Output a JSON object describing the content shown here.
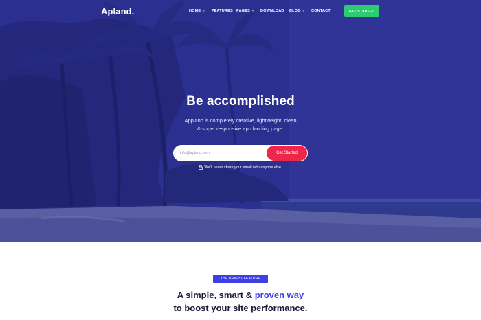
{
  "brand": {
    "name": "Apland."
  },
  "nav": {
    "items": [
      {
        "label": "HOME",
        "has_dropdown": true
      },
      {
        "label": "FEATURES",
        "has_dropdown": false
      },
      {
        "label": "PAGES",
        "has_dropdown": true
      },
      {
        "label": "DOWNLOAD",
        "has_dropdown": false
      },
      {
        "label": "BLOG",
        "has_dropdown": true
      },
      {
        "label": "CONTACT",
        "has_dropdown": false
      }
    ],
    "cta_label": "GET STARTED"
  },
  "hero": {
    "title": "Be accomplished",
    "subtitle": "Appland is completely creative, lightweight, clean & super responsive app landing page.",
    "email_placeholder": "info@apland.com",
    "submit_label": "Get Started",
    "privacy_note": "We'll never share your email with anyone else."
  },
  "feature": {
    "badge": "THE BRIGHT FEATURE",
    "title_part1": "A simple, smart & ",
    "title_accent": "proven way",
    "title_part2": "to boost your site performance."
  },
  "colors": {
    "hero_overlay": "#2a2f8e",
    "cta_green": "#2ecc71",
    "button_red": "#f0254a",
    "accent_blue": "#3f3fe8",
    "heading_dark": "#1a1b3a"
  },
  "icons": {
    "dropdown": "chevron-down-icon",
    "privacy": "lock-icon"
  }
}
